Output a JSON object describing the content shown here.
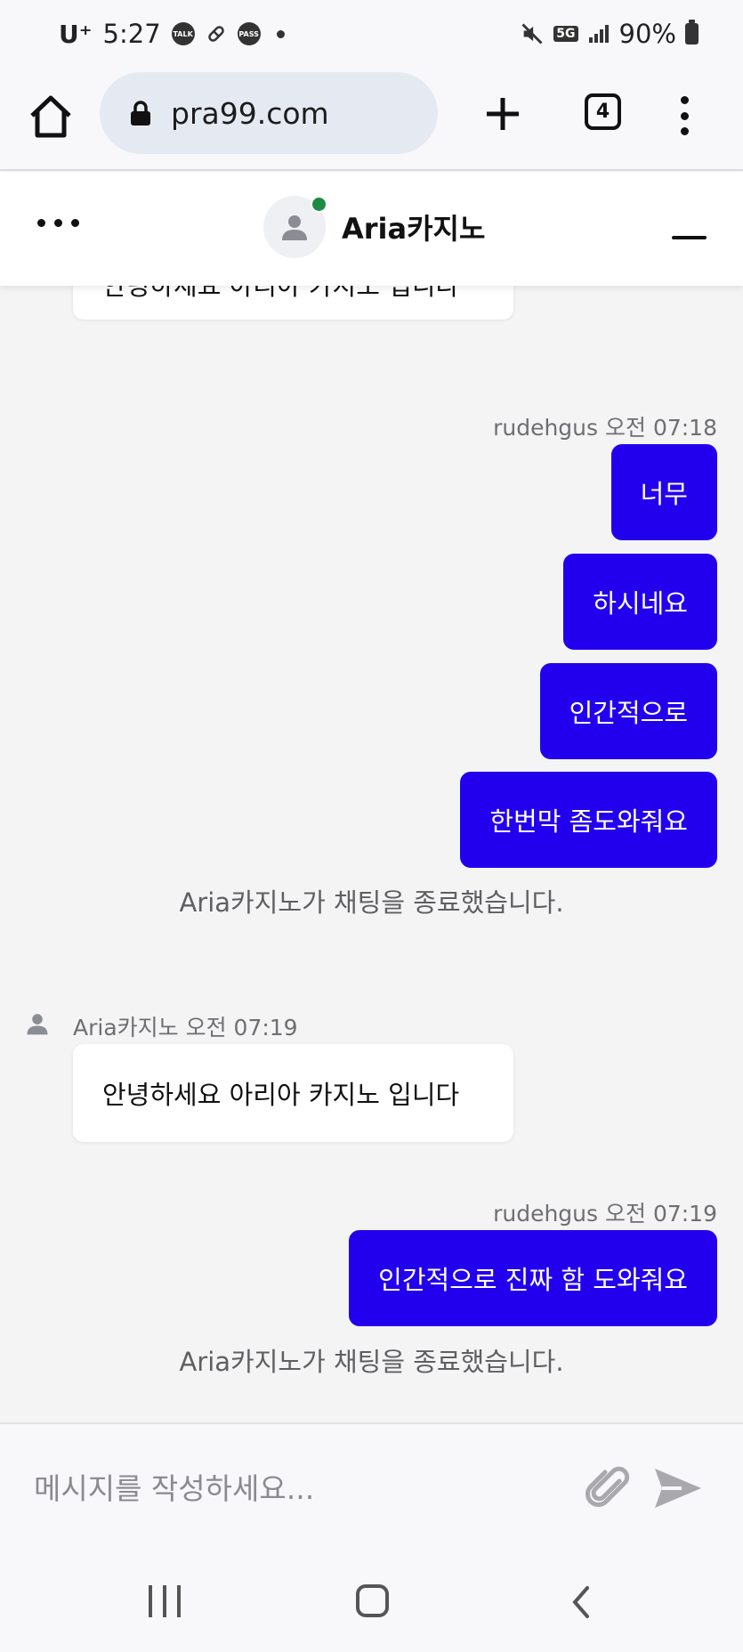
{
  "status_bar": {
    "carrier": "U⁺",
    "time": "5:27",
    "notif_talk": "TALK",
    "notif_pass": "PASS",
    "network": "5G",
    "battery": "90%"
  },
  "browser": {
    "url": "pra99.com",
    "tab_count": "4"
  },
  "chat_header": {
    "title": "Aria카지노"
  },
  "messages": {
    "bot_1": {
      "text": "안녕하세요 아리아 카지노 입니다"
    },
    "user_meta_1": "rudehgus 오전 07:18",
    "user_group_1": [
      "너무",
      "하시네요",
      "인간적으로",
      "한번막 좀도와줘요"
    ],
    "system_1": "Aria카지노가 채팅을 종료했습니다.",
    "bot_meta_2": "Aria카지노 오전 07:19",
    "bot_2": {
      "text": "안녕하세요 아리아 카지노 입니다"
    },
    "user_meta_2": "rudehgus 오전 07:19",
    "user_group_2": [
      "인간적으로 진짜 함 도와줘요"
    ],
    "system_2": "Aria카지노가 채팅을 종료했습니다."
  },
  "input": {
    "placeholder": "메시지를 작성하세요...",
    "value": ""
  },
  "icons": {
    "home": "home-icon",
    "lock": "lock-icon",
    "new_tab": "plus-icon",
    "tabs": "tab-switcher-icon",
    "menu": "more-vert-icon",
    "chat_menu": "more-horiz-icon",
    "avatar": "person-icon",
    "minimize": "minimize-icon",
    "attach": "paperclip-icon",
    "send": "send-icon"
  },
  "colors": {
    "user_bubble": "#2200ee",
    "online": "#1e8a45"
  }
}
